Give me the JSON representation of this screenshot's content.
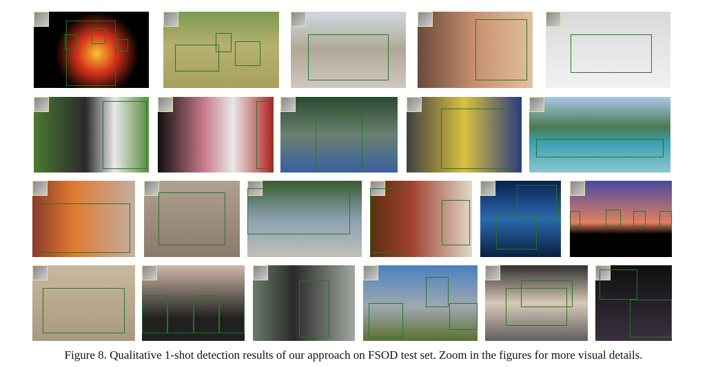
{
  "figure": {
    "caption": "Figure 8. Qualitative 1-shot detection results of our approach on FSOD test set. Zoom in the figures for more visual details."
  },
  "colors": {
    "detection_box": "#1f7a1f",
    "support_border": "#e8e0a0"
  }
}
